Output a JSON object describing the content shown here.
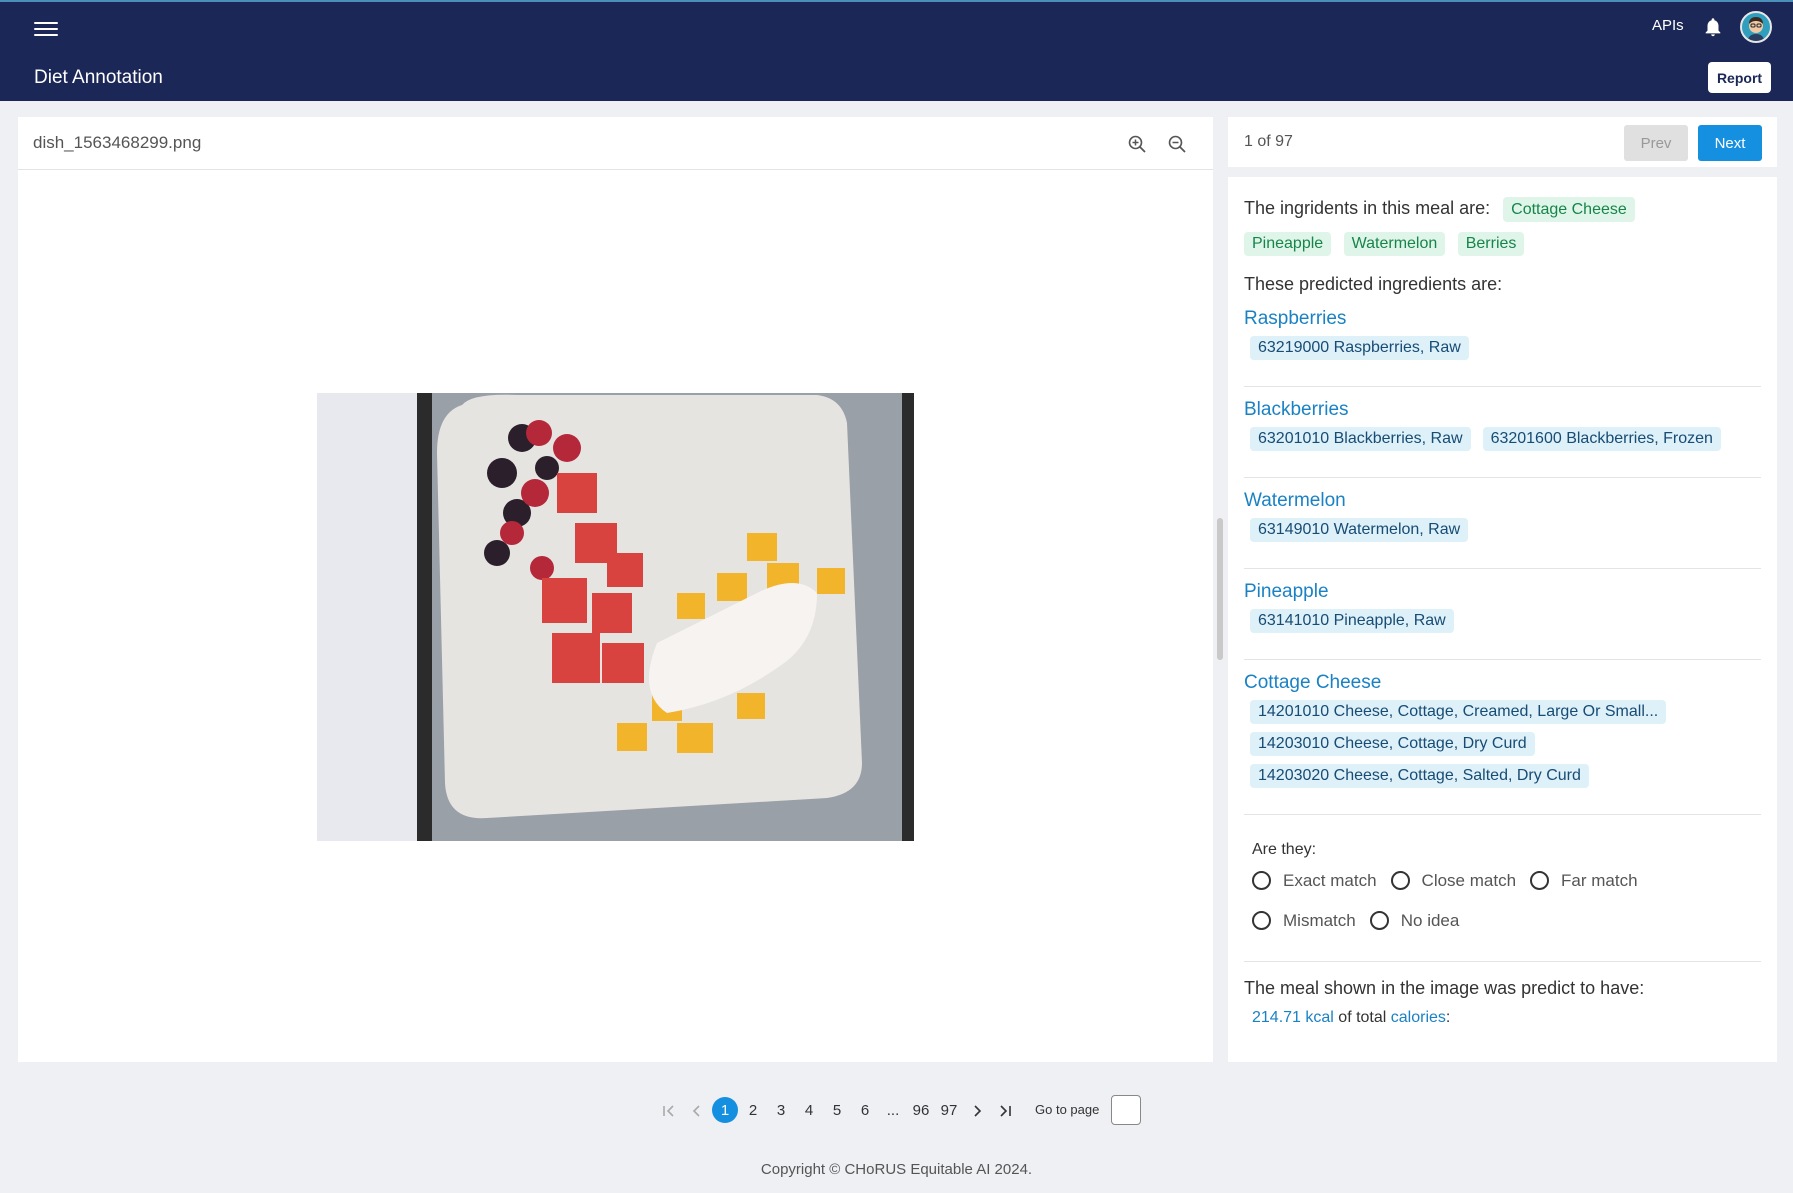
{
  "header": {
    "apis_label": "APIs",
    "app_title": "Diet Annotation",
    "report_label": "Report"
  },
  "image_panel": {
    "filename": "dish_1563468299.png"
  },
  "nav": {
    "counter": "1 of 97",
    "prev_label": "Prev",
    "next_label": "Next"
  },
  "ingredients": {
    "intro": "The ingridents in this meal are:",
    "items": [
      "Cottage Cheese",
      "Pineapple",
      "Watermelon",
      "Berries"
    ]
  },
  "predicted": {
    "intro": "These predicted ingredients are:",
    "groups": [
      {
        "name": "Raspberries",
        "codes": [
          "63219000 Raspberries, Raw"
        ]
      },
      {
        "name": "Blackberries",
        "codes": [
          "63201010 Blackberries, Raw",
          "63201600 Blackberries, Frozen"
        ]
      },
      {
        "name": "Watermelon",
        "codes": [
          "63149010 Watermelon, Raw"
        ]
      },
      {
        "name": "Pineapple",
        "codes": [
          "63141010 Pineapple, Raw"
        ]
      },
      {
        "name": "Cottage Cheese",
        "codes": [
          "14201010 Cheese, Cottage, Creamed, Large Or Small...",
          "14203010 Cheese, Cottage, Dry Curd",
          "14203020 Cheese, Cottage, Salted, Dry Curd"
        ]
      }
    ]
  },
  "match": {
    "question": "Are they:",
    "options": [
      "Exact match",
      "Close match",
      "Far match",
      "Mismatch",
      "No idea"
    ]
  },
  "calories": {
    "intro": "The meal shown in the image was predict to have:",
    "value": "214.71 kcal",
    "middle": "of total",
    "word": "calories",
    "colon": ":"
  },
  "pagination": {
    "pages": [
      "1",
      "2",
      "3",
      "4",
      "5",
      "6",
      "...",
      "96",
      "97"
    ],
    "active": "1",
    "goto_label": "Go to page"
  },
  "footer": {
    "copyright": "Copyright © CHoRUS Equitable AI 2024."
  },
  "colors": {
    "navbar": "#1a2757",
    "accent": "#1590e0",
    "chip_green_bg": "#dff5e9",
    "chip_blue_bg": "#def0f8"
  }
}
